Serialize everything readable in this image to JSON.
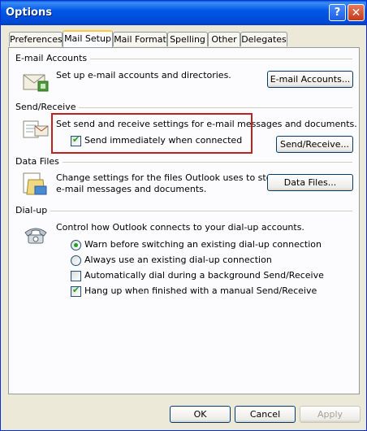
{
  "window": {
    "title": "Options"
  },
  "titlebar": {
    "help_glyph": "?",
    "close_glyph": "✕"
  },
  "tabs": [
    {
      "label": "Preferences",
      "active": false
    },
    {
      "label": "Mail Setup",
      "active": true
    },
    {
      "label": "Mail Format",
      "active": false
    },
    {
      "label": "Spelling",
      "active": false
    },
    {
      "label": "Other",
      "active": false
    },
    {
      "label": "Delegates",
      "active": false
    }
  ],
  "email_accounts": {
    "heading": "E-mail Accounts",
    "description": "Set up e-mail accounts and directories.",
    "button": "E-mail Accounts...",
    "icon": "email-accounts-icon"
  },
  "send_receive": {
    "heading": "Send/Receive",
    "description": "Set send and receive settings for e-mail messages and documents.",
    "checkbox_label": "Send immediately when connected",
    "checkbox_checked": true,
    "button": "Send/Receive...",
    "icon": "send-receive-icon"
  },
  "data_files": {
    "heading": "Data Files",
    "description_line1": "Change settings for the files Outlook uses to store",
    "description_line2": "e-mail messages and documents.",
    "button": "Data Files...",
    "icon": "data-files-icon"
  },
  "dialup": {
    "heading": "Dial-up",
    "description": "Control how Outlook connects to your dial-up accounts.",
    "radio_warn": "Warn before switching an existing dial-up connection",
    "radio_always": "Always use an existing dial-up connection",
    "selected_radio": "warn",
    "checkbox_auto_dial": "Automatically dial during a background Send/Receive",
    "checkbox_auto_dial_checked": false,
    "checkbox_hang_up": "Hang up when finished with a manual Send/Receive",
    "checkbox_hang_up_checked": true,
    "icon": "telephone-icon"
  },
  "footer": {
    "ok": "OK",
    "cancel": "Cancel",
    "apply": "Apply"
  },
  "colors": {
    "titlebar": "#0058e6",
    "highlight_border": "#c0201e",
    "check": "#21a121"
  }
}
